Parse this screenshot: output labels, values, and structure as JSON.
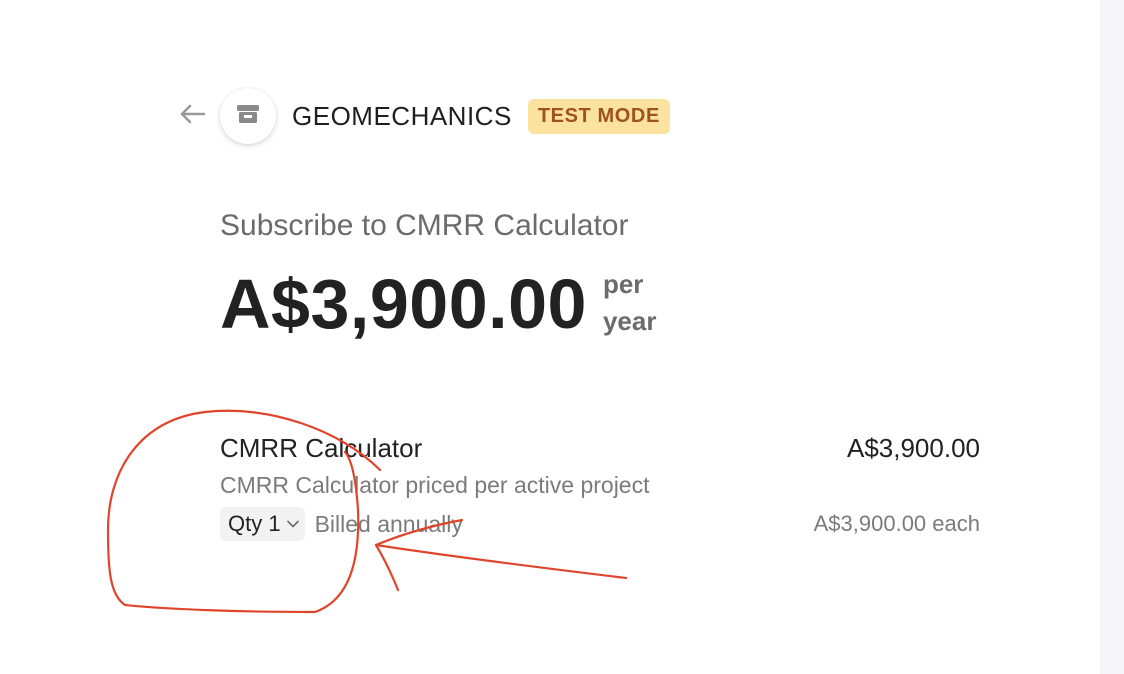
{
  "header": {
    "merchant_name": "GEOMECHANICS",
    "test_badge": "TEST MODE"
  },
  "checkout": {
    "title": "Subscribe to CMRR Calculator",
    "price": "A$3,900.00",
    "period_line1": "per",
    "period_line2": "year"
  },
  "line_item": {
    "name": "CMRR Calculator",
    "total": "A$3,900.00",
    "description": "CMRR Calculator priced per active project",
    "qty_label": "Qty 1",
    "billing": "Billed annually",
    "unit_price": "A$3,900.00 each"
  },
  "icons": {
    "back": "arrow-left-icon",
    "logo": "storefront-icon",
    "qty": "chevron-down-icon"
  },
  "colors": {
    "badge_bg": "#fbe29f",
    "badge_text": "#a0521d",
    "annotation": "#e0442a"
  }
}
